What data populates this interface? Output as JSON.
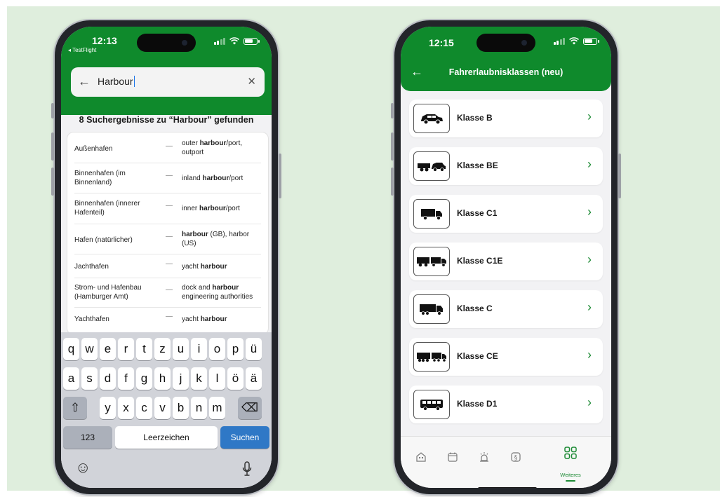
{
  "left_phone": {
    "status": {
      "time": "12:13",
      "back_app": "◂ TestFlight"
    },
    "search": {
      "value": "Harbour",
      "back_icon": "arrow-left-icon",
      "clear_icon": "close-icon"
    },
    "results_title": "8 Suchergebnisse zu “Harbour” gefunden",
    "results": [
      {
        "de": "Außenhafen",
        "pre": "outer ",
        "bold": "harbour",
        "post": "/port, outport"
      },
      {
        "de": "Binnenhafen (im Binnenland)",
        "pre": "inland ",
        "bold": "harbour",
        "post": "/port"
      },
      {
        "de": "Binnenhafen (innerer Hafenteil)",
        "pre": "inner ",
        "bold": "harbour",
        "post": "/port"
      },
      {
        "de": "Hafen (natürlicher)",
        "pre": "",
        "bold": "harbour",
        "post": " (GB), harbor (US)"
      },
      {
        "de": "Jachthafen",
        "pre": "yacht ",
        "bold": "harbour",
        "post": ""
      },
      {
        "de": "Strom- und Hafenbau (Hamburger Amt)",
        "pre": "dock and ",
        "bold": "harbour",
        "post": " engineering authorities"
      },
      {
        "de": "Yachthafen",
        "pre": "yacht ",
        "bold": "harbour",
        "post": ""
      }
    ],
    "dash": "—",
    "keyboard": {
      "row1": [
        "q",
        "w",
        "e",
        "r",
        "t",
        "z",
        "u",
        "i",
        "o",
        "p",
        "ü"
      ],
      "row2": [
        "a",
        "s",
        "d",
        "f",
        "g",
        "h",
        "j",
        "k",
        "l",
        "ö",
        "ä"
      ],
      "row3": [
        "y",
        "x",
        "c",
        "v",
        "b",
        "n",
        "m"
      ],
      "shift": "⇧",
      "backspace": "⌫",
      "numbers": "123",
      "space": "Leerzeichen",
      "search": "Suchen",
      "emoji": "☺",
      "mic": "🎙"
    }
  },
  "right_phone": {
    "status": {
      "time": "12:15"
    },
    "nav_title": "Fahrerlaubnisklassen (neu)",
    "items": [
      {
        "label": "Klasse B",
        "icon": "car-icon"
      },
      {
        "label": "Klasse BE",
        "icon": "car-trailer-icon"
      },
      {
        "label": "Klasse C1",
        "icon": "small-truck-icon"
      },
      {
        "label": "Klasse C1E",
        "icon": "small-truck-trailer-icon"
      },
      {
        "label": "Klasse C",
        "icon": "truck-icon"
      },
      {
        "label": "Klasse CE",
        "icon": "truck-trailer-icon"
      },
      {
        "label": "Klasse D1",
        "icon": "bus-icon"
      }
    ],
    "tabs": [
      {
        "icon": "home-icon"
      },
      {
        "icon": "calendar-icon"
      },
      {
        "icon": "alarm-icon"
      },
      {
        "icon": "paragraph-icon"
      },
      {
        "icon": "grid-icon",
        "label": "Weiteres",
        "active": true
      }
    ]
  },
  "colors": {
    "brand_green": "#0f8a2c",
    "accent_green": "#1c8a34",
    "keyboard_blue": "#2f78c6",
    "background": "#dfeedd"
  }
}
